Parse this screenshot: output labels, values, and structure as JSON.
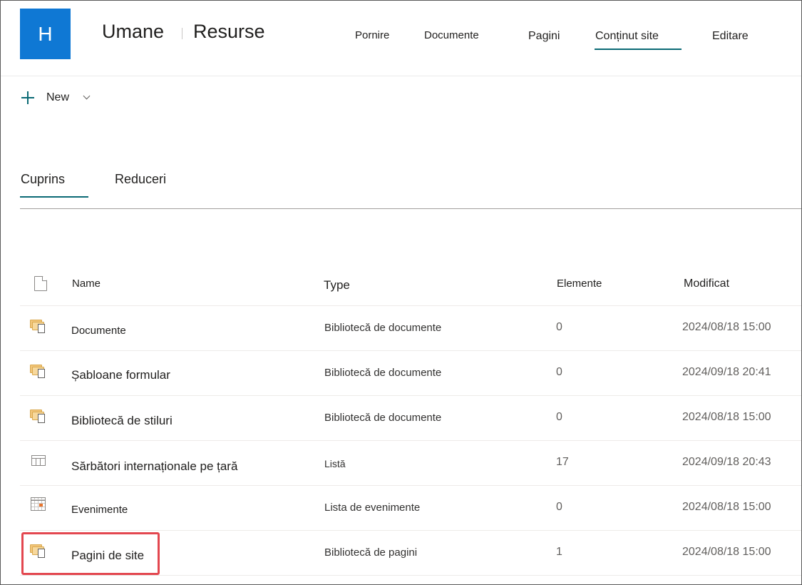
{
  "site": {
    "logo_letter": "H",
    "title_part1": "Umane",
    "title_part2": "Resurse"
  },
  "topnav": {
    "items": [
      {
        "label": "Pornire"
      },
      {
        "label": "Documente"
      },
      {
        "label": "Pagini"
      },
      {
        "label": "Conținut site",
        "selected": true
      },
      {
        "label": "Editare"
      }
    ]
  },
  "command_bar": {
    "new_label": "New"
  },
  "tabs": [
    {
      "label": "Cuprins",
      "selected": true
    },
    {
      "label": "Reduceri"
    }
  ],
  "table": {
    "columns": {
      "name": "Name",
      "type": "Type",
      "items": "Elemente",
      "modified": "Modificat"
    },
    "rows": [
      {
        "icon": "document-library-icon",
        "name": "Documente",
        "type": "Bibliotecă de documente",
        "items": "0",
        "modified": "2024/08/18 15:00"
      },
      {
        "icon": "document-library-icon",
        "name": "Șabloane formular",
        "type": "Bibliotecă de documente",
        "items": "0",
        "modified": "2024/09/18 20:41"
      },
      {
        "icon": "document-library-icon",
        "name": "Bibliotecă de stiluri",
        "type": "Bibliotecă de documente",
        "items": "0",
        "modified": "2024/08/18 15:00"
      },
      {
        "icon": "list-icon",
        "name": "Sărbători internaționale pe țară",
        "type": "Listă",
        "items": "17",
        "modified": "2024/09/18 20:43"
      },
      {
        "icon": "calendar-icon",
        "name": "Evenimente",
        "type": "Lista de evenimente",
        "items": "0",
        "modified": "2024/08/18 15:00"
      },
      {
        "icon": "document-library-icon",
        "name": "Pagini de site",
        "type": "Bibliotecă de pagini",
        "items": "1",
        "modified": "2024/08/18 15:00",
        "highlighted": true
      }
    ]
  },
  "colors": {
    "brand_blue": "#0f78d4",
    "accent_teal": "#0b6a75",
    "highlight_red": "#e3474f"
  }
}
